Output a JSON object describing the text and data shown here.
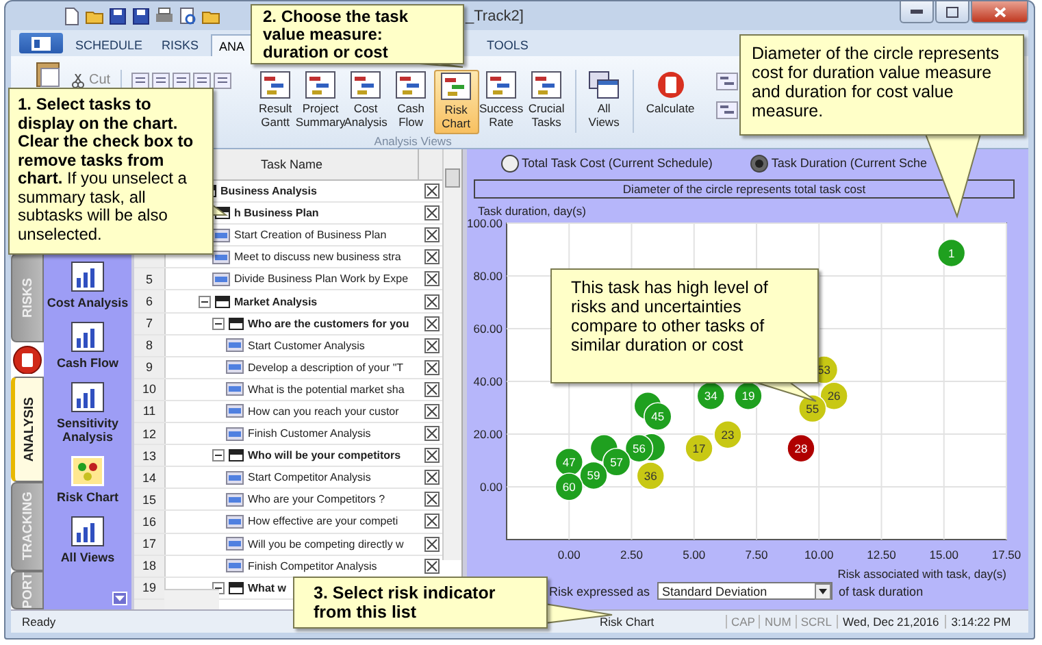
{
  "window": {
    "title": "_Track2]"
  },
  "tabs": [
    {
      "label": "SCHEDULE",
      "selected": false
    },
    {
      "label": "RISKS",
      "selected": false
    },
    {
      "label": "ANA",
      "selected": true
    },
    {
      "label": "TOOLS",
      "selected": false
    }
  ],
  "ribbon": {
    "cut": "Cut",
    "views": [
      {
        "label": "Result Gantt",
        "selected": false
      },
      {
        "label": "Project Summary",
        "selected": false
      },
      {
        "label": "Cost Analysis",
        "selected": false
      },
      {
        "label": "Cash Flow",
        "selected": false
      },
      {
        "label": "Risk Chart",
        "selected": true
      },
      {
        "label": "Success Rate",
        "selected": false
      },
      {
        "label": "Crucial Tasks",
        "selected": false
      }
    ],
    "group_label": "Analysis Views",
    "all_views": "All Views",
    "calculate": "Calculate"
  },
  "sidebar": {
    "tabs": [
      {
        "label": "RISKS",
        "selected": false
      },
      {
        "label": "ANALYSIS",
        "selected": true
      },
      {
        "label": "TRACKING",
        "selected": false
      },
      {
        "label": "PORT",
        "selected": false
      }
    ],
    "items": [
      {
        "label": "Cost Analysis",
        "selected": false
      },
      {
        "label": "Cash Flow",
        "selected": false
      },
      {
        "label": "Sensitivity Analysis",
        "selected": false
      },
      {
        "label": "Risk Chart",
        "selected": true
      },
      {
        "label": "All Views",
        "selected": false
      }
    ]
  },
  "grid": {
    "header": "Task Name",
    "rows": [
      {
        "kind": "summary",
        "name": "Business Analysis",
        "checked": true,
        "children": [
          {
            "kind": "summary",
            "name": "h Business Plan",
            "checked": true,
            "children": [
              {
                "kind": "task",
                "name": "Start Creation of Business Plan",
                "checked": true
              },
              {
                "kind": "task",
                "name": "Meet to discuss new business stra",
                "checked": true
              },
              {
                "kind": "task",
                "number": "5",
                "name": "Divide Business Plan Work by Expe",
                "checked": true
              }
            ]
          },
          {
            "kind": "summary",
            "number": "6",
            "name": "Market Analysis",
            "checked": true,
            "children": [
              {
                "kind": "summary",
                "number": "7",
                "name": "Who are the customers for you",
                "checked": true,
                "children": [
                  {
                    "kind": "task",
                    "number": "8",
                    "name": "Start Customer Analysis",
                    "checked": true
                  },
                  {
                    "kind": "task",
                    "number": "9",
                    "name": "Develop a description of your \"T",
                    "checked": true
                  },
                  {
                    "kind": "task",
                    "number": "10",
                    "name": "What is the potential market sha",
                    "checked": true
                  },
                  {
                    "kind": "task",
                    "number": "11",
                    "name": "How can you reach your custor",
                    "checked": true
                  },
                  {
                    "kind": "task",
                    "number": "12",
                    "name": "Finish Customer Analysis",
                    "checked": true
                  }
                ]
              },
              {
                "kind": "summary",
                "number": "13",
                "name": "Who will be your competitors",
                "checked": true,
                "children": [
                  {
                    "kind": "task",
                    "number": "14",
                    "name": "Start Competitor Analysis",
                    "checked": true
                  },
                  {
                    "kind": "task",
                    "number": "15",
                    "name": "Who are your Competitors ?",
                    "checked": true
                  },
                  {
                    "kind": "task",
                    "number": "16",
                    "name": "How effective are your competi",
                    "checked": true
                  },
                  {
                    "kind": "task",
                    "number": "17",
                    "name": "Will you be competing directly w",
                    "checked": true
                  },
                  {
                    "kind": "task",
                    "number": "18",
                    "name": "Finish Competitor Analysis",
                    "checked": true
                  }
                ]
              },
              {
                "kind": "summary",
                "number": "19",
                "name": "What w"
              }
            ]
          }
        ]
      }
    ]
  },
  "chart": {
    "options": [
      {
        "label": "Total Task Cost (Current Schedule)",
        "selected": false
      },
      {
        "label": "Task Duration (Current Sche",
        "selected": true
      }
    ],
    "caption": "Diameter of the circle represents total task cost",
    "chart_data": {
      "type": "scatter",
      "ylabel": "Task duration, day(s)",
      "xlabel": "Risk associated with task, day(s)",
      "xlim": [
        -2.5,
        17.5
      ],
      "ylim": [
        -20,
        100
      ],
      "xticks": [
        {
          "value": 0,
          "label": "0.00"
        },
        {
          "value": 2.5,
          "label": "2.50"
        },
        {
          "value": 5,
          "label": "5.00"
        },
        {
          "value": 7.5,
          "label": "7.50"
        },
        {
          "value": 10,
          "label": "10.00"
        },
        {
          "value": 12.5,
          "label": "12.50"
        },
        {
          "value": 15,
          "label": "15.00"
        },
        {
          "value": 17.5,
          "label": "17.50"
        }
      ],
      "yticks": [
        {
          "value": 0,
          "label": "0.00"
        },
        {
          "value": 20,
          "label": "20.00"
        },
        {
          "value": 40,
          "label": "40.00"
        },
        {
          "value": 60,
          "label": "60.00"
        },
        {
          "value": 80,
          "label": "80.00"
        },
        {
          "value": 100,
          "label": "100.00"
        }
      ],
      "grid": true,
      "x": [
        3.15,
        1.4,
        3.3,
        15.3,
        7.17,
        5.67,
        3.55,
        2.8,
        1.9,
        0,
        0.98,
        0,
        10.2,
        10.6,
        9.74,
        5.2,
        6.35,
        3.26,
        9.28
      ],
      "series": [
        {
          "color": "#1fa01f",
          "values": [
            30.7,
            14.6,
            15,
            88.7,
            34.5,
            34.5,
            26.7,
            14.6,
            9.4,
            9.4,
            4.3,
            0,
            null,
            null,
            null,
            null,
            null,
            null,
            null
          ]
        },
        {
          "color": "#c8c814",
          "values": [
            null,
            null,
            null,
            null,
            null,
            null,
            null,
            null,
            null,
            null,
            null,
            null,
            44.4,
            34.5,
            29.7,
            14.6,
            19.8,
            4.2,
            null
          ]
        },
        {
          "color": "#b00000",
          "values": [
            null,
            null,
            null,
            null,
            null,
            null,
            null,
            null,
            null,
            null,
            null,
            null,
            null,
            null,
            null,
            null,
            null,
            null,
            14.6
          ]
        }
      ],
      "annotations": [
        {
          "x": 15.3,
          "y": 88.7,
          "text": "1"
        },
        {
          "x": 7.17,
          "y": 34.5,
          "text": "19"
        },
        {
          "x": 5.67,
          "y": 34.5,
          "text": "34"
        },
        {
          "x": 3.55,
          "y": 26.7,
          "text": "45"
        },
        {
          "x": 2.8,
          "y": 14.6,
          "text": "56"
        },
        {
          "x": 1.9,
          "y": 9.4,
          "text": "57"
        },
        {
          "x": 0,
          "y": 9.4,
          "text": "47"
        },
        {
          "x": 0.98,
          "y": 4.3,
          "text": "59"
        },
        {
          "x": 0,
          "y": 0,
          "text": "60"
        },
        {
          "x": 10.2,
          "y": 44.4,
          "text": "53"
        },
        {
          "x": 10.6,
          "y": 34.5,
          "text": "26"
        },
        {
          "x": 9.74,
          "y": 29.7,
          "text": "55"
        },
        {
          "x": 5.2,
          "y": 14.6,
          "text": "17"
        },
        {
          "x": 6.35,
          "y": 19.8,
          "text": "23"
        },
        {
          "x": 3.26,
          "y": 4.2,
          "text": "36"
        },
        {
          "x": 9.28,
          "y": 14.6,
          "text": "28"
        }
      ]
    },
    "risk_label": "Risk expressed as",
    "risk_value": "Standard Deviation",
    "risk_suffix": "of task duration"
  },
  "callouts": [
    {
      "text": "**1. Select tasks to display on the chart. Clear the check box to remove tasks from chart.** If you unselect a summary task, all subtasks will be also unselected."
    },
    {
      "text": "**2. Choose the task value measure: duration or cost**"
    },
    {
      "text": "Diameter of the circle represents cost for duration value measure and duration for cost value measure."
    },
    {
      "text": "This task has high level of risks and uncertainties compare to other tasks of similar duration or cost"
    },
    {
      "text": "**3. Select risk indicator from this list**"
    }
  ],
  "status_bar": {
    "state": "Ready",
    "view": "Risk Chart",
    "indicators": [
      "CAP",
      "NUM",
      "SCRL"
    ],
    "date": "Wed, Dec 21,2016",
    "time": "3:14:22 PM"
  }
}
